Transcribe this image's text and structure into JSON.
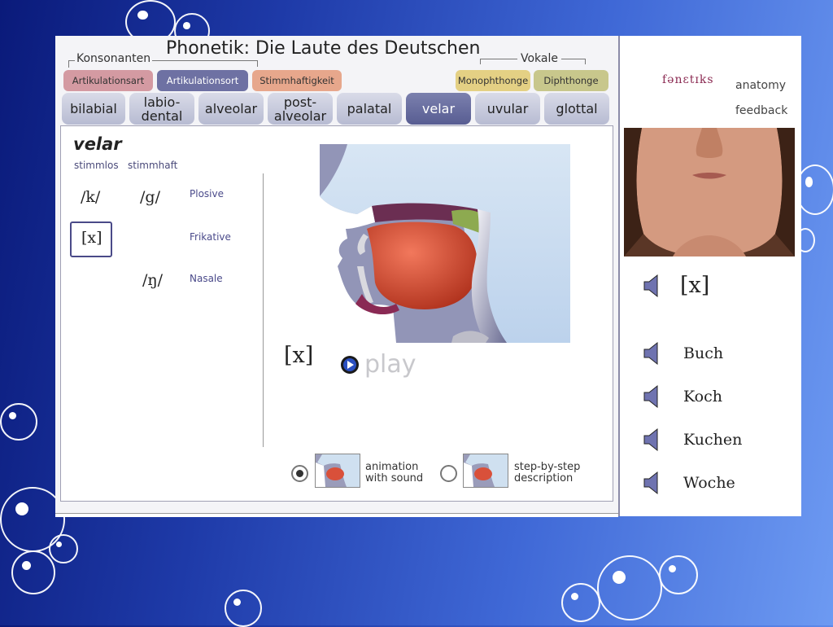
{
  "title": "Phonetik:  Die Laute des Deutschen",
  "groups": {
    "consonants": "Konsonanten",
    "vowels": "Vokale"
  },
  "categories": [
    {
      "label": "Artikulationsart",
      "color": "#d49aa2",
      "text_color": "#333333"
    },
    {
      "label": "Artikulationsort",
      "color": "#6e71a3",
      "text_color": "#ffffff"
    },
    {
      "label": "Stimmhaftigkeit",
      "color": "#e7a78c",
      "text_color": "#333333"
    },
    {
      "label": "Monophthonge",
      "color": "#e4d084",
      "text_color": "#333333"
    },
    {
      "label": "Diphthonge",
      "color": "#c8c78c",
      "text_color": "#333333"
    }
  ],
  "places": [
    {
      "label": "bilabial"
    },
    {
      "label": "labio-\ndental"
    },
    {
      "label": "alveolar"
    },
    {
      "label": "post-\nalveolar"
    },
    {
      "label": "palatal"
    },
    {
      "label": "velar",
      "active": true
    },
    {
      "label": "uvular"
    },
    {
      "label": "glottal"
    }
  ],
  "content": {
    "place_title": "velar",
    "voiceless": "stimmlos",
    "voiced": "stimmhaft",
    "phonemes": {
      "plosive_voiceless": "/k/",
      "plosive_voiced": "/g/",
      "fricative_voiceless": "[x]",
      "nasal_voiced": "/ŋ/"
    },
    "manners": {
      "plosive": "Plosive",
      "fricative": "Frikative",
      "nasal": "Nasale"
    },
    "current_sound": "[x]",
    "play_label": "play",
    "options": [
      {
        "label_line1": "animation",
        "label_line2": "with sound",
        "selected": true
      },
      {
        "label_line1": "step-by-step",
        "label_line2": "description",
        "selected": false
      }
    ]
  },
  "side": {
    "logo": "fənɛtɪks",
    "links": [
      "anatomy",
      "feedback"
    ],
    "sound_label": "[x]",
    "words": [
      "Buch",
      "Koch",
      "Kuchen",
      "Woche"
    ]
  }
}
